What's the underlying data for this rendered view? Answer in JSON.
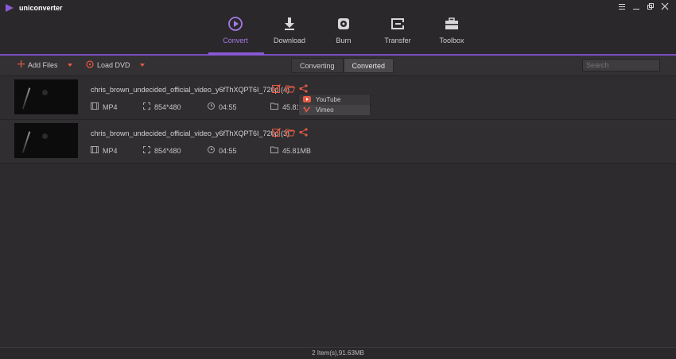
{
  "app": {
    "name": "uniconverter"
  },
  "window_controls": [
    "menu-icon",
    "minimize-icon",
    "restore-icon",
    "close-icon"
  ],
  "nav": {
    "items": [
      {
        "label": "Convert",
        "icon": "convert-play-icon",
        "active": true
      },
      {
        "label": "Download",
        "icon": "download-icon",
        "active": false
      },
      {
        "label": "Burn",
        "icon": "disc-icon",
        "active": false
      },
      {
        "label": "Transfer",
        "icon": "transfer-icon",
        "active": false
      },
      {
        "label": "Toolbox",
        "icon": "toolbox-icon",
        "active": false
      }
    ]
  },
  "toolbar": {
    "add_files": "Add Files",
    "load_dvd": "Load DVD",
    "tabs": [
      {
        "label": "Converting",
        "active": false
      },
      {
        "label": "Converted",
        "active": true
      }
    ],
    "search_placeholder": "Search"
  },
  "files": [
    {
      "name": "chris_brown_undecided_official_video_y6fThXQPT6I_720p (4)",
      "format": "MP4",
      "resolution": "854*480",
      "duration": "04:55",
      "size": "45.81MB"
    },
    {
      "name": "chris_brown_undecided_official_video_y6fThXQPT6I_720p (3)",
      "format": "MP4",
      "resolution": "854*480",
      "duration": "04:55",
      "size": "45.81MB"
    }
  ],
  "share_menu": {
    "items": [
      {
        "label": "YouTube",
        "icon": "youtube-icon"
      },
      {
        "label": "Vimeo",
        "icon": "vimeo-icon"
      }
    ]
  },
  "status": {
    "text": "2 Item(s),91.63MB"
  },
  "colors": {
    "accent": "#8a5bd6",
    "action": "#e45a43",
    "bg": "#2d2b2e"
  }
}
